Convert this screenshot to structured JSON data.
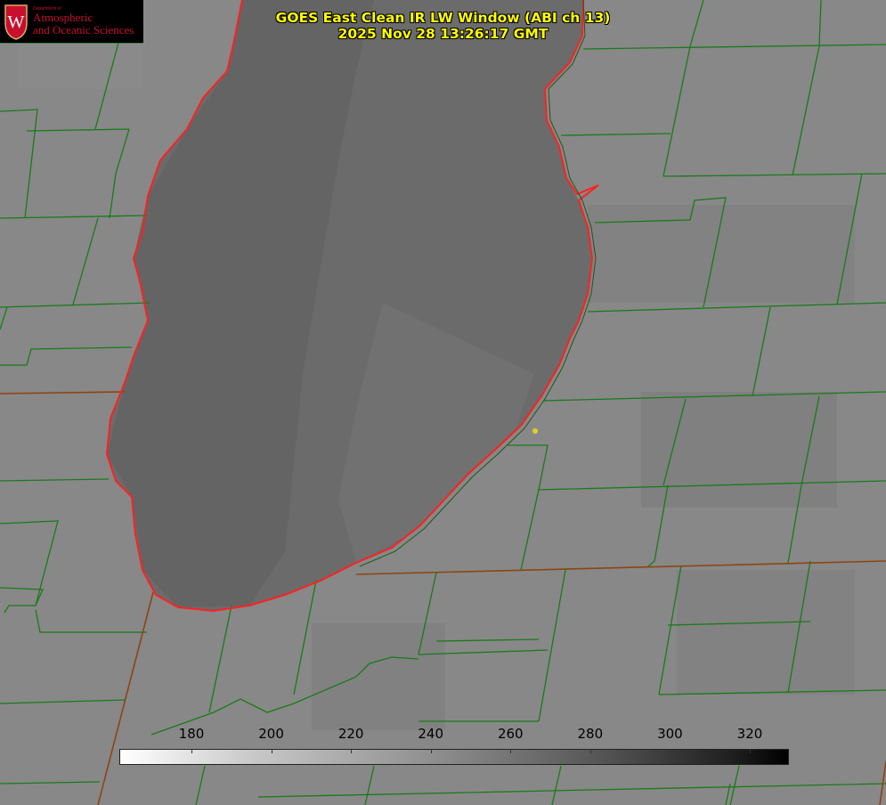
{
  "title": {
    "line1": "GOES East Clean IR LW Window (ABI ch 13)",
    "line2": "2025 Nov 28 13:26:17 GMT"
  },
  "logo": {
    "department": "Department of",
    "line1": "Atmospheric",
    "line2": "and Oceanic Sciences",
    "crest_letter": "W"
  },
  "colorbar": {
    "unit": "",
    "tick_labels": [
      "180",
      "200",
      "220",
      "240",
      "260",
      "280",
      "300",
      "320"
    ],
    "tick_values": [
      180,
      200,
      220,
      240,
      260,
      280,
      300,
      320
    ],
    "gradient": "light-to-dark grayscale"
  },
  "colors": {
    "background_land": "#888888",
    "lake": "#6b6b6b",
    "county_lines": "#1a7a1a",
    "state_lines": "#8b4513",
    "coastline": "#ff2020",
    "title_text": "#ffff00",
    "marker": "#e0d020",
    "logo_red": "#c8102e"
  }
}
